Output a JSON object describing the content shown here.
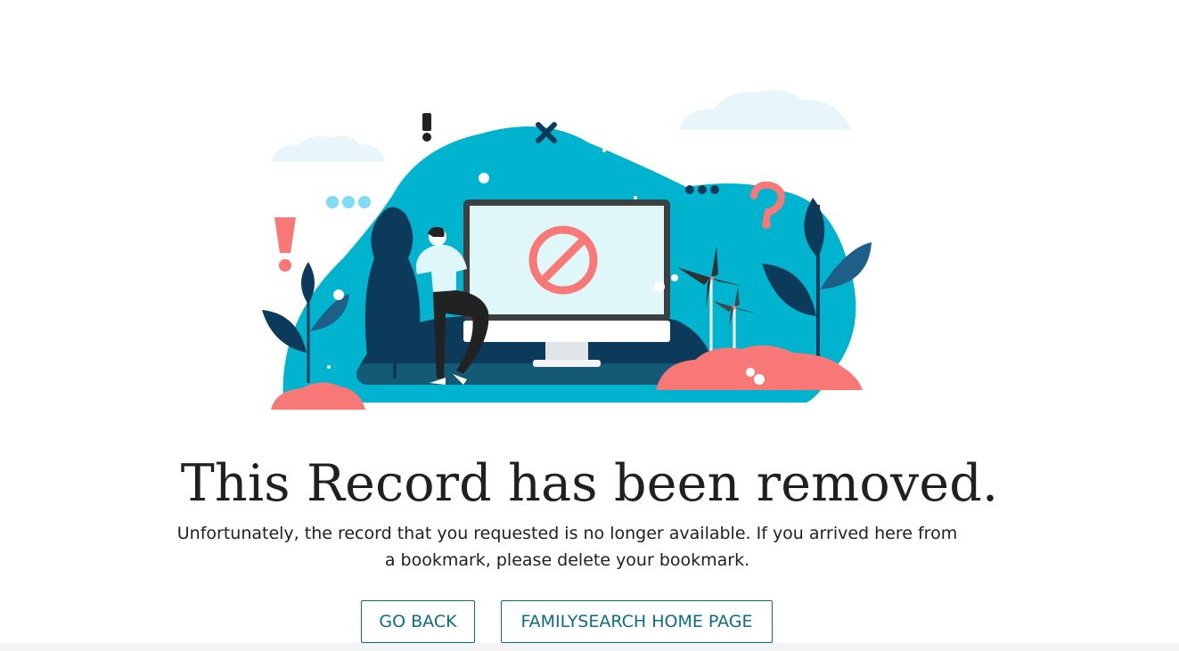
{
  "page": {
    "title": "This Record has been removed.",
    "message": "Unfortunately, the record that you requested is no longer available. If you arrived here from a bookmark, please delete your bookmark."
  },
  "actions": {
    "go_back_label": "GO BACK",
    "home_label": "FAMILYSEARCH HOME PAGE"
  },
  "illustration": {
    "icon": "removed-record-illustration",
    "colors": {
      "teal": "#00b4d0",
      "navy": "#0b3a5b",
      "coral": "#f87878",
      "light_blue": "#e8f5fb",
      "screen": "#dff7f9",
      "monitor": "#3d3f42"
    }
  },
  "theme": {
    "button_color": "#0c6d85",
    "text_color": "#202020"
  }
}
